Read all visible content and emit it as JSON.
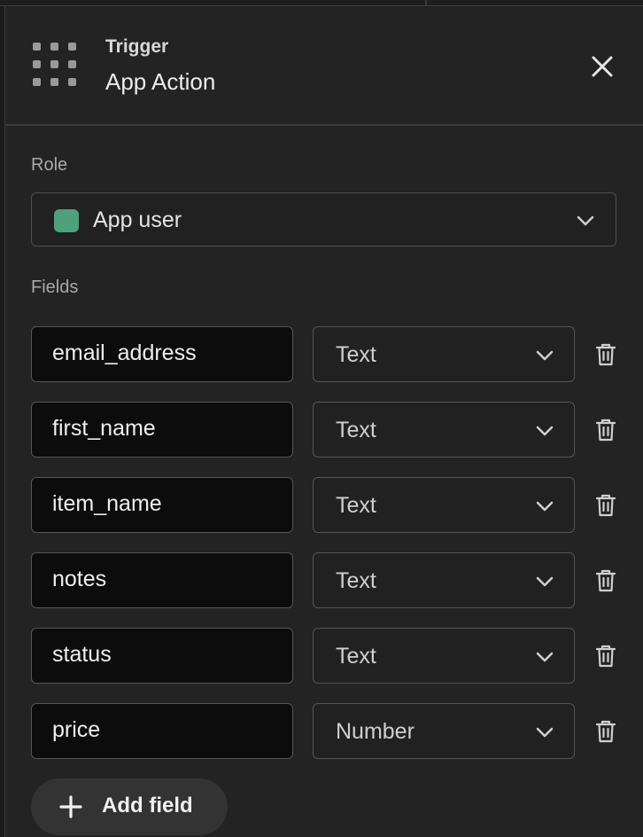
{
  "header": {
    "kicker": "Trigger",
    "title": "App Action",
    "icon": "grid-icon",
    "close_icon": "close-icon"
  },
  "role": {
    "label": "Role",
    "value": "App user",
    "swatch_color": "#4fa07c"
  },
  "fields": {
    "label": "Fields",
    "rows": [
      {
        "name": "email_address",
        "type": "Text"
      },
      {
        "name": "first_name",
        "type": "Text"
      },
      {
        "name": "item_name",
        "type": "Text"
      },
      {
        "name": "notes",
        "type": "Text"
      },
      {
        "name": "status",
        "type": "Text"
      },
      {
        "name": "price",
        "type": "Number"
      }
    ],
    "delete_icon": "trash-icon"
  },
  "add_field": {
    "label": "Add field",
    "icon": "plus-icon"
  }
}
